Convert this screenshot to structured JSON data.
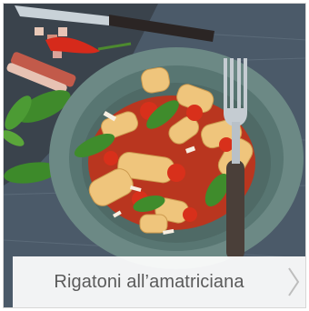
{
  "recipe_card": {
    "title": "Rigatoni all’amatriciana",
    "next_icon": "chevron-right-icon"
  },
  "colors": {
    "caption_text": "#5a5a5a",
    "caption_bg": "#ffffff",
    "chevron": "#bdbdbd",
    "sauce": "#c8321e",
    "pasta": "#eec27a",
    "bowl": "#6e8a86",
    "tabletop": "#4a5968"
  }
}
